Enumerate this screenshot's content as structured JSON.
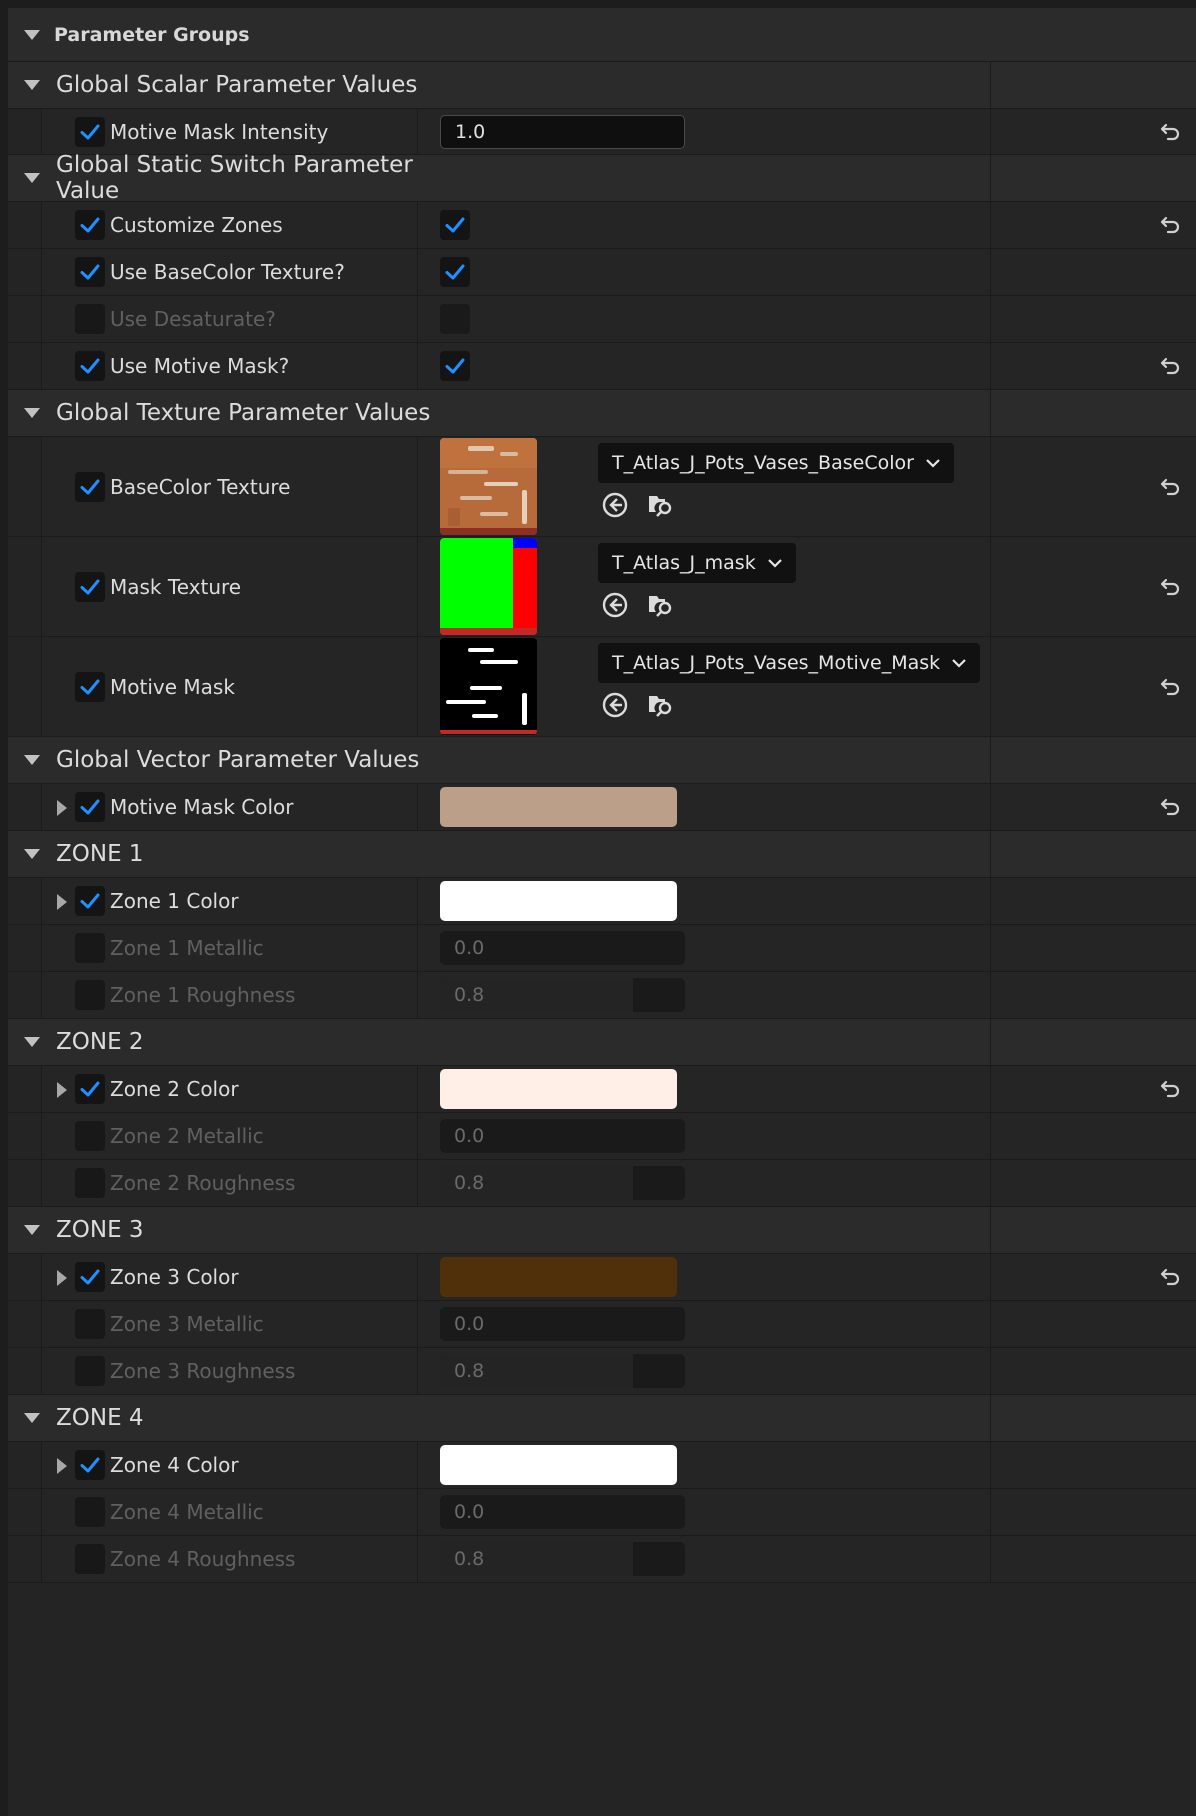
{
  "header": {
    "title": "Parameter Groups"
  },
  "groups": {
    "scalar": {
      "title": "Global Scalar Parameter Values",
      "motive_mask_intensity": {
        "label": "Motive Mask Intensity",
        "value": "1.0"
      }
    },
    "switch": {
      "title": "Global Static Switch Parameter Value",
      "customize_zones": {
        "label": "Customize Zones"
      },
      "use_basecolor_texture": {
        "label": "Use BaseColor Texture?"
      },
      "use_desaturate": {
        "label": "Use Desaturate?"
      },
      "use_motive_mask": {
        "label": "Use Motive Mask?"
      }
    },
    "texture": {
      "title": "Global Texture Parameter Values",
      "basecolor": {
        "label": "BaseColor Texture",
        "asset": "T_Atlas_J_Pots_Vases_BaseColor"
      },
      "mask": {
        "label": "Mask Texture",
        "asset": "T_Atlas_J_mask"
      },
      "motive": {
        "label": "Motive Mask",
        "asset": "T_Atlas_J_Pots_Vases_Motive_Mask"
      }
    },
    "vector": {
      "title": "Global Vector Parameter Values",
      "motive_mask_color": {
        "label": "Motive Mask Color",
        "color": "#bb9f88"
      }
    },
    "zone1": {
      "title": "ZONE 1",
      "color": {
        "label": "Zone 1 Color",
        "color": "#ffffff"
      },
      "metallic": {
        "label": "Zone 1 Metallic",
        "value": "0.0"
      },
      "roughness": {
        "label": "Zone 1 Roughness",
        "value": "0.8"
      }
    },
    "zone2": {
      "title": "ZONE 2",
      "color": {
        "label": "Zone 2 Color",
        "color": "#ffefe6"
      },
      "metallic": {
        "label": "Zone 2 Metallic",
        "value": "0.0"
      },
      "roughness": {
        "label": "Zone 2 Roughness",
        "value": "0.8"
      }
    },
    "zone3": {
      "title": "ZONE 3",
      "color": {
        "label": "Zone 3 Color",
        "color": "#4f300b"
      },
      "metallic": {
        "label": "Zone 3 Metallic",
        "value": "0.0"
      },
      "roughness": {
        "label": "Zone 3 Roughness",
        "value": "0.8"
      }
    },
    "zone4": {
      "title": "ZONE 4",
      "color": {
        "label": "Zone 4 Color",
        "color": "#ffffff"
      },
      "metallic": {
        "label": "Zone 4 Metallic",
        "value": "0.0"
      },
      "roughness": {
        "label": "Zone 4 Roughness",
        "value": "0.8"
      }
    }
  },
  "theme": {
    "accent": "#1e90ff",
    "panel": "#242424",
    "header": "#2b2b2b",
    "field": "#141414"
  }
}
